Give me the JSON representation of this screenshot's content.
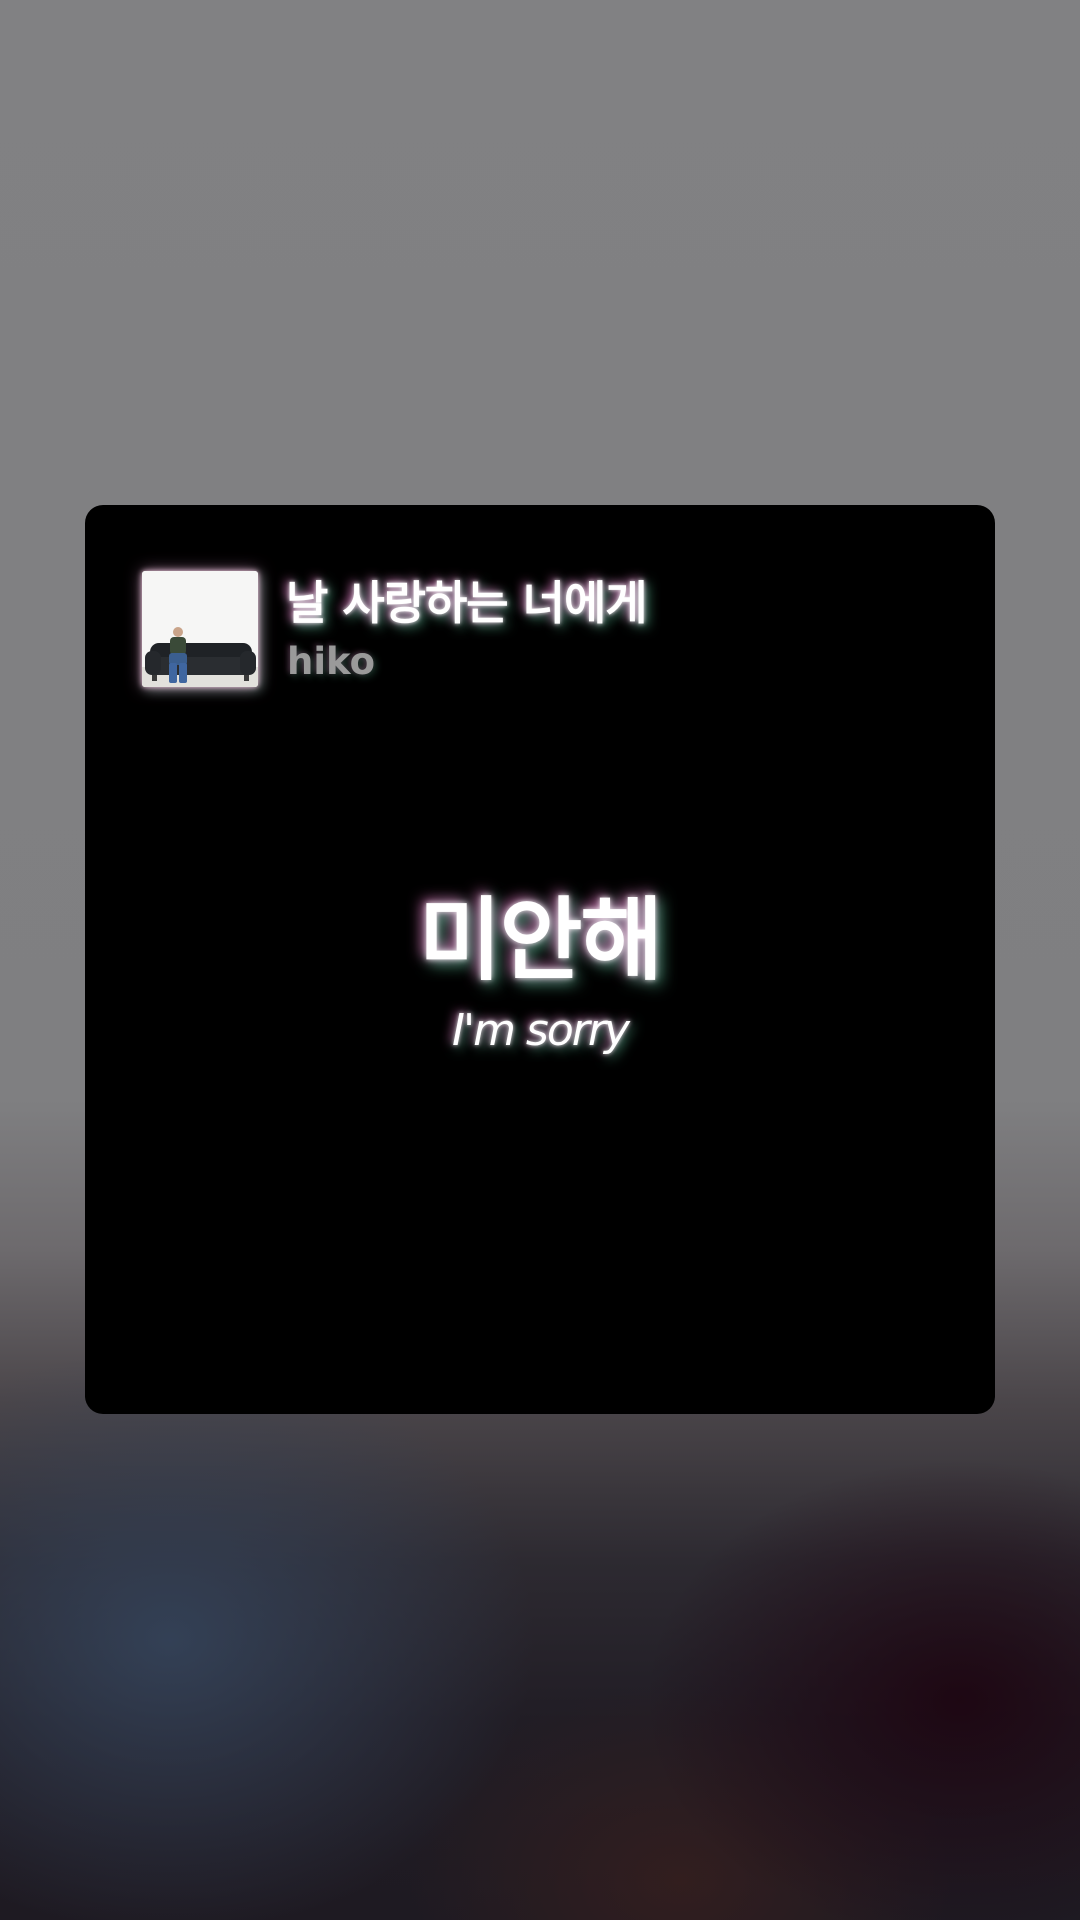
{
  "now_playing": {
    "title": "날 사랑하는 너에게",
    "artist": "hiko",
    "album_art_icon": "album-cover-person-on-sofa"
  },
  "lyrics": {
    "current_line": "미안해",
    "current_translation": "I'm sorry"
  },
  "colors": {
    "card_background": "#000000",
    "glow_pink": "#ff78d2",
    "glow_mint": "#78ffc8",
    "artist_text": "#9a9a9a"
  }
}
